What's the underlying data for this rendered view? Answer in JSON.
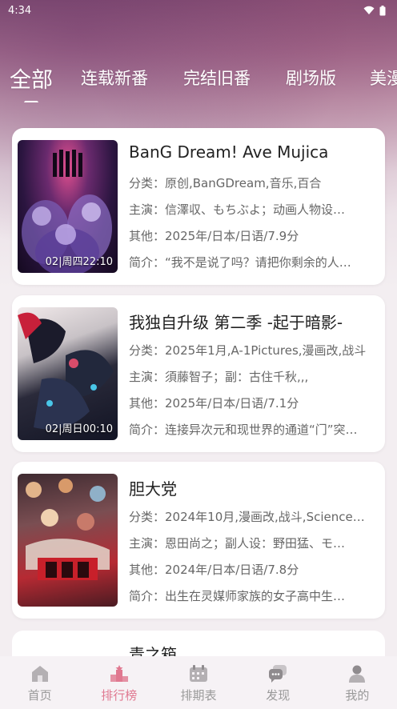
{
  "status": {
    "time": "4:34"
  },
  "tabs": [
    {
      "label": "全部"
    },
    {
      "label": "连载新番"
    },
    {
      "label": "完结旧番"
    },
    {
      "label": "剧场版"
    },
    {
      "label": "美漫"
    }
  ],
  "cards": [
    {
      "title": "BanG Dream! Ave Mujica",
      "category": "分类：原创,BanGDream,音乐,百合",
      "cast": "主演：信澤収、もちぶよ；动画人物设…",
      "other": "其他：2025年/日本/日语/7.9分",
      "intro": "简介：“我不是说了吗？请把你剩余的人…",
      "episode": "02|周四22:10"
    },
    {
      "title": "我独自升级 第二季 -起于暗影-",
      "category": "分类：2025年1月,A-1Pictures,漫画改,战斗",
      "cast": "主演：須藤智子；副：古住千秋,,,",
      "other": "其他：2025年/日本/日语/7.1分",
      "intro": "简介：连接异次元和现世界的通道“门”突…",
      "episode": "02|周日00:10"
    },
    {
      "title": "胆大党",
      "category": "分类：2024年10月,漫画改,战斗,Science…",
      "cast": "主演：恩田尚之；副人设：野田猛、モ…",
      "other": "其他：2024年/日本/日语/7.8分",
      "intro": "简介：出生在灵媒师家族的女子高中生…",
      "episode": ""
    }
  ],
  "peek": {
    "title": "青之箱"
  },
  "nav": [
    {
      "label": "首页",
      "icon": "home-icon"
    },
    {
      "label": "排行榜",
      "icon": "ranking-icon"
    },
    {
      "label": "排期表",
      "icon": "calendar-icon"
    },
    {
      "label": "发现",
      "icon": "chat-icon"
    },
    {
      "label": "我的",
      "icon": "person-icon"
    }
  ],
  "colors": {
    "accent": "#e07890",
    "inactive": "#999999"
  }
}
